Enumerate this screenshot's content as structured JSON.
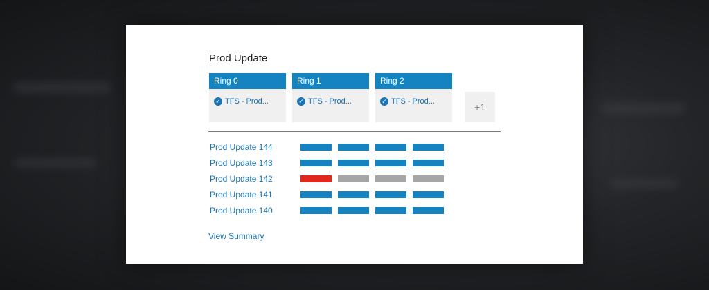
{
  "widget": {
    "title": "Prod Update",
    "environments": [
      {
        "name": "Ring 0",
        "deployment": "TFS - Prod..."
      },
      {
        "name": "Ring 1",
        "deployment": "TFS - Prod..."
      },
      {
        "name": "Ring 2",
        "deployment": "TFS - Prod..."
      }
    ],
    "more_environments": "+1",
    "releases": [
      {
        "name": "Prod Update 144",
        "statuses": [
          "succeeded",
          "succeeded",
          "succeeded",
          "succeeded"
        ]
      },
      {
        "name": "Prod Update 143",
        "statuses": [
          "succeeded",
          "succeeded",
          "succeeded",
          "succeeded"
        ]
      },
      {
        "name": "Prod Update 142",
        "statuses": [
          "failed",
          "not-deployed",
          "not-deployed",
          "not-deployed"
        ]
      },
      {
        "name": "Prod Update 141",
        "statuses": [
          "succeeded",
          "succeeded",
          "succeeded",
          "succeeded"
        ]
      },
      {
        "name": "Prod Update 140",
        "statuses": [
          "succeeded",
          "succeeded",
          "succeeded",
          "succeeded"
        ]
      }
    ],
    "view_summary": "View Summary"
  },
  "colors": {
    "succeeded": "#1483c0",
    "failed": "#e0291a",
    "not-deployed": "#a6a6a6"
  }
}
